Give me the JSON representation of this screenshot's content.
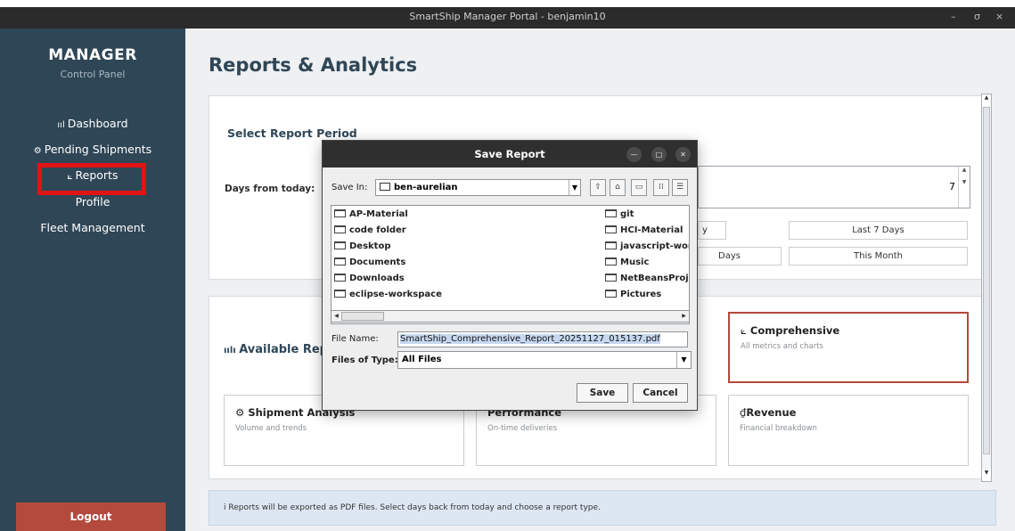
{
  "window": {
    "title": "SmartShip Manager Portal - benjamin10",
    "controls": [
      "–",
      "σ",
      "×"
    ]
  },
  "sidebar": {
    "brand_title": "MANAGER",
    "brand_subtitle": "Control Panel",
    "items": [
      {
        "label": "Dashboard",
        "icon": "ııl"
      },
      {
        "label": "Pending Shipments",
        "icon": "⚙"
      },
      {
        "label": "Reports",
        "icon": "⟀"
      },
      {
        "label": "Profile",
        "icon": ""
      },
      {
        "label": "Fleet Management",
        "icon": ""
      }
    ],
    "logout_label": "Logout",
    "highlight_color": "#e01414"
  },
  "main": {
    "page_title": "Reports & Analytics",
    "period": {
      "title": "Select Report Period",
      "days_label": "Days from today:",
      "days_value": "7",
      "buttons": [
        "y",
        "Last 7 Days",
        "Days",
        "This Month"
      ]
    },
    "reports": {
      "title": "Available Repo",
      "tiles": [
        {
          "title": "Comprehensive",
          "subtitle": "All metrics and charts",
          "icon": "⟀",
          "selected": true
        },
        {
          "title": "Shipment Analysis",
          "subtitle": "Volume and trends",
          "icon": "⚙"
        },
        {
          "title": "Performance",
          "subtitle": "On-time deliveries",
          "icon": ""
        },
        {
          "title": "Revenue",
          "subtitle": "Financial breakdown",
          "icon": "₫"
        }
      ]
    },
    "info_text": "i Reports will be exported as PDF files. Select days back from today and choose a report type."
  },
  "dialog": {
    "title": "Save Report",
    "save_in_label": "Save In:",
    "save_in_value": "ben-aurelian",
    "folders_left": [
      "AP-Material",
      "code folder",
      "Desktop",
      "Documents",
      "Downloads",
      "eclipse-workspace"
    ],
    "folders_right": [
      "git",
      "HCI-Material",
      "javascript-work",
      "Music",
      "NetBeansProjec",
      "Pictures"
    ],
    "file_name_label": "File Name:",
    "file_name_value": "SmartShip_Comprehensive_Report_20251127_015137.pdf",
    "file_type_label": "Files of Type:",
    "file_type_value": "All Files",
    "save_button": "Save",
    "cancel_button": "Cancel"
  },
  "colors": {
    "sidebar_bg": "#2f4656",
    "accent_red": "#b34a3d",
    "title_text": "#2f4656"
  }
}
